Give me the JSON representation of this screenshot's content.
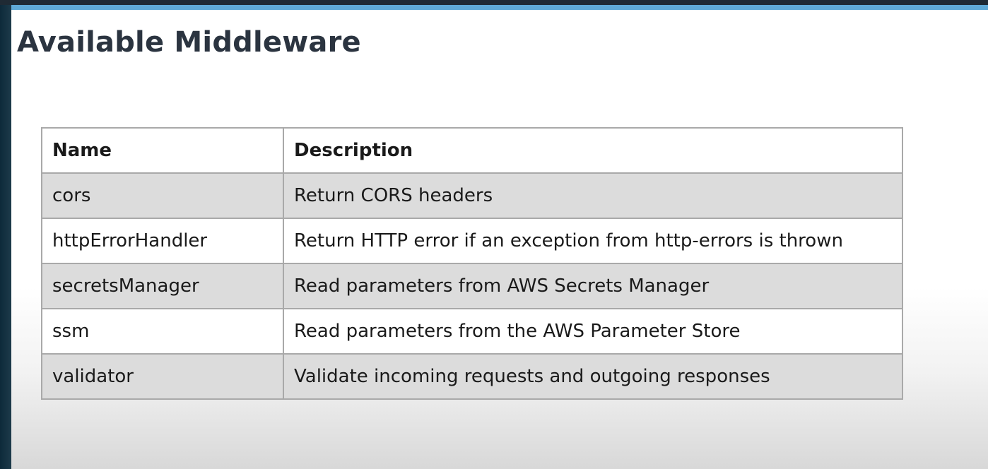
{
  "slide": {
    "title": "Available Middleware"
  },
  "table": {
    "headers": {
      "name": "Name",
      "description": "Description"
    },
    "rows": [
      {
        "name": "cors",
        "description": "Return CORS headers"
      },
      {
        "name": "httpErrorHandler",
        "description": "Return HTTP error if an exception from http-errors is thrown"
      },
      {
        "name": "secretsManager",
        "description": "Read parameters from AWS Secrets Manager"
      },
      {
        "name": "ssm",
        "description": "Read parameters from the AWS Parameter Store"
      },
      {
        "name": "validator",
        "description": "Validate incoming requests and outgoing responses"
      }
    ]
  },
  "colors": {
    "accent": "#5fa9d6",
    "title": "#2b3440",
    "shaded_row": "#dcdcdc"
  }
}
